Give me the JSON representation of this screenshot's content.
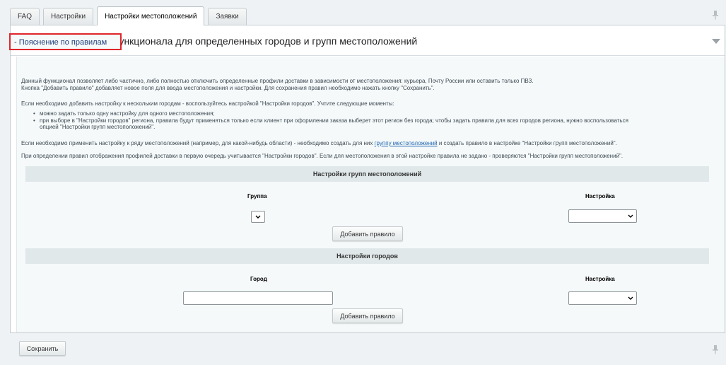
{
  "tabs": [
    {
      "label": "FAQ",
      "active": false
    },
    {
      "label": "Настройки",
      "active": false
    },
    {
      "label": "Настройки местоположений",
      "active": true
    },
    {
      "label": "Заявки",
      "active": false
    }
  ],
  "panel": {
    "title": "Отключение частей функционала для определенных городов и групп местоположений",
    "rules_toggle": "- Пояснение по правилам"
  },
  "help": {
    "p1_line1": "Данный функционал позволяет либо частично, либо полностью отключить определенные профили доставки в зависимости от местоположения: курьера, Почту России или оставить только ПВЗ.",
    "p1_line2": "Кнопка \"Добавить правило\" добавляет новое поля для ввода местоположения и настройки. Для сохранения правил необходимо нажать кнопку \"Сохранить\".",
    "p2": "Если необходимо добавить настройку к нескольким городам - воспользуйтесь настройкой \"Настройки городов\". Учтите следующие моменты:",
    "bullet1": "можно задать только одну настройку для одного местоположения;",
    "bullet2_line1": "при выборе в \"Настройки городов\" региона, правила будут применяться только если клиент при оформлении заказа выберет этот регион без города; чтобы задать правила для всех городов региона, нужно воспользоваться",
    "bullet2_line2": "опцией \"Настройки групп местоположений\".",
    "p3_before": "Если необходимо применить настройку к ряду местоположений (например, для какой-нибудь области) - необходимо создать для них ",
    "p3_link": "группу местоположений",
    "p3_after": " и создать правило в настройке \"Настройки групп местоположений\".",
    "p4": "При определении правил отображения профилей доставки в первую очередь учитывается \"Настройки городов\". Если для местоположения в этой настройке правила не задано - проверяются \"Настройки групп местоположений\"."
  },
  "groups_section": {
    "title": "Настройки групп местоположений",
    "col_group": "Группа",
    "col_setting": "Настройка",
    "add_button": "Добавить правило"
  },
  "cities_section": {
    "title": "Настройки городов",
    "col_city": "Город",
    "col_setting": "Настройка",
    "city_value": "",
    "add_button": "Добавить правило"
  },
  "footer": {
    "save_button": "Сохранить"
  },
  "colors": {
    "highlight_border": "#e0252b",
    "link": "#2067b0",
    "section_bg": "#e0e8ea"
  }
}
